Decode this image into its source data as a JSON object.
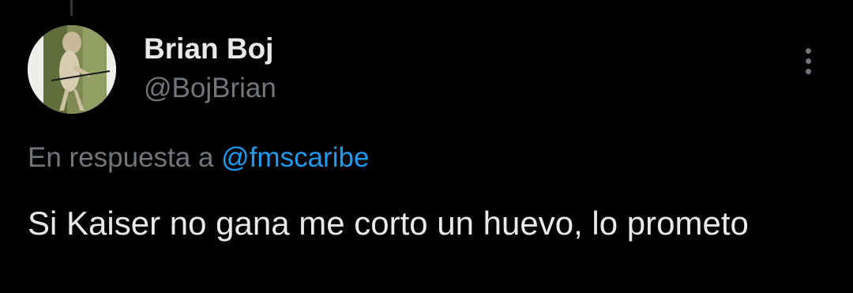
{
  "tweet": {
    "author": {
      "display_name": "Brian Boj",
      "handle": "@BojBrian"
    },
    "reply_prefix": "En respuesta a",
    "reply_to": "@fmscaribe",
    "text": "Si Kaiser no gana me corto un huevo, lo prometo"
  },
  "icons": {
    "more": "more-vertical-icon"
  },
  "colors": {
    "background": "#000000",
    "primary_text": "#e7e9ea",
    "secondary_text": "#71767b",
    "accent": "#1d9bf0"
  }
}
